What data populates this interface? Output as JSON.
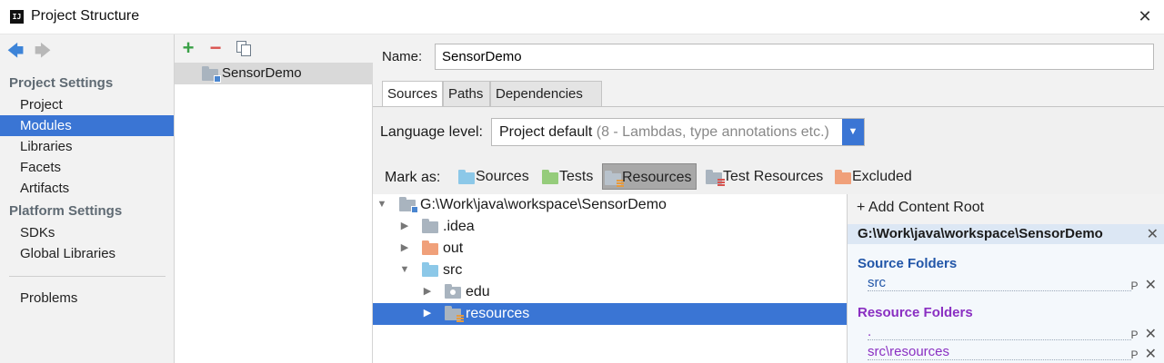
{
  "window": {
    "title": "Project Structure",
    "app_icon_text": "IJ",
    "close_glyph": "✕"
  },
  "nav": {
    "back_glyph": "🡄",
    "forward_glyph": "🡆",
    "project_settings": "Project Settings",
    "platform_settings": "Platform Settings",
    "items": {
      "project": "Project",
      "modules": "Modules",
      "libraries": "Libraries",
      "facets": "Facets",
      "artifacts": "Artifacts",
      "sdks": "SDKs",
      "global_libraries": "Global Libraries",
      "problems": "Problems"
    },
    "selected": "Modules"
  },
  "modules": {
    "add_glyph": "+",
    "remove_glyph": "−",
    "list": [
      "SensorDemo"
    ],
    "selected": "SensorDemo"
  },
  "module": {
    "name_label": "Name:",
    "name_value": "SensorDemo",
    "tabs": {
      "sources": "Sources",
      "paths": "Paths",
      "dependencies": "Dependencies"
    },
    "active_tab": "Sources",
    "language_level_label": "Language level:",
    "language_level_value": "Project default",
    "language_level_hint": "(8 - Lambdas, type annotations etc.)",
    "dropdown_glyph": "▼",
    "mark_as_label": "Mark as:",
    "mark_as": {
      "sources": "Sources",
      "tests": "Tests",
      "resources": "Resources",
      "test_resources": "Test Resources",
      "excluded": "Excluded"
    },
    "mark_as_active": "Resources"
  },
  "tree": {
    "root": "G:\\Work\\java\\workspace\\SensorDemo",
    "idea": ".idea",
    "out": "out",
    "src": "src",
    "edu": "edu",
    "resources": "resources",
    "expanded_glyph": "▼",
    "collapsed_glyph": "▶",
    "selected": "resources"
  },
  "content_root": {
    "add_label": "+ Add Content Root",
    "root_path": "G:\\Work\\java\\workspace\\SensorDemo",
    "source_folders_label": "Source Folders",
    "source_folders": [
      "src"
    ],
    "resource_folders_label": "Resource Folders",
    "resource_folders": [
      ".",
      "src\\resources"
    ],
    "edit_glyph": "P",
    "remove_glyph": "✕"
  },
  "colors": {
    "selection": "#3a75d4",
    "source_folder": "#8cc8e8",
    "test_folder": "#95cc7b",
    "excluded_folder": "#f0a07a",
    "source_text": "#2256a8",
    "resource_text": "#8a2fc2"
  }
}
